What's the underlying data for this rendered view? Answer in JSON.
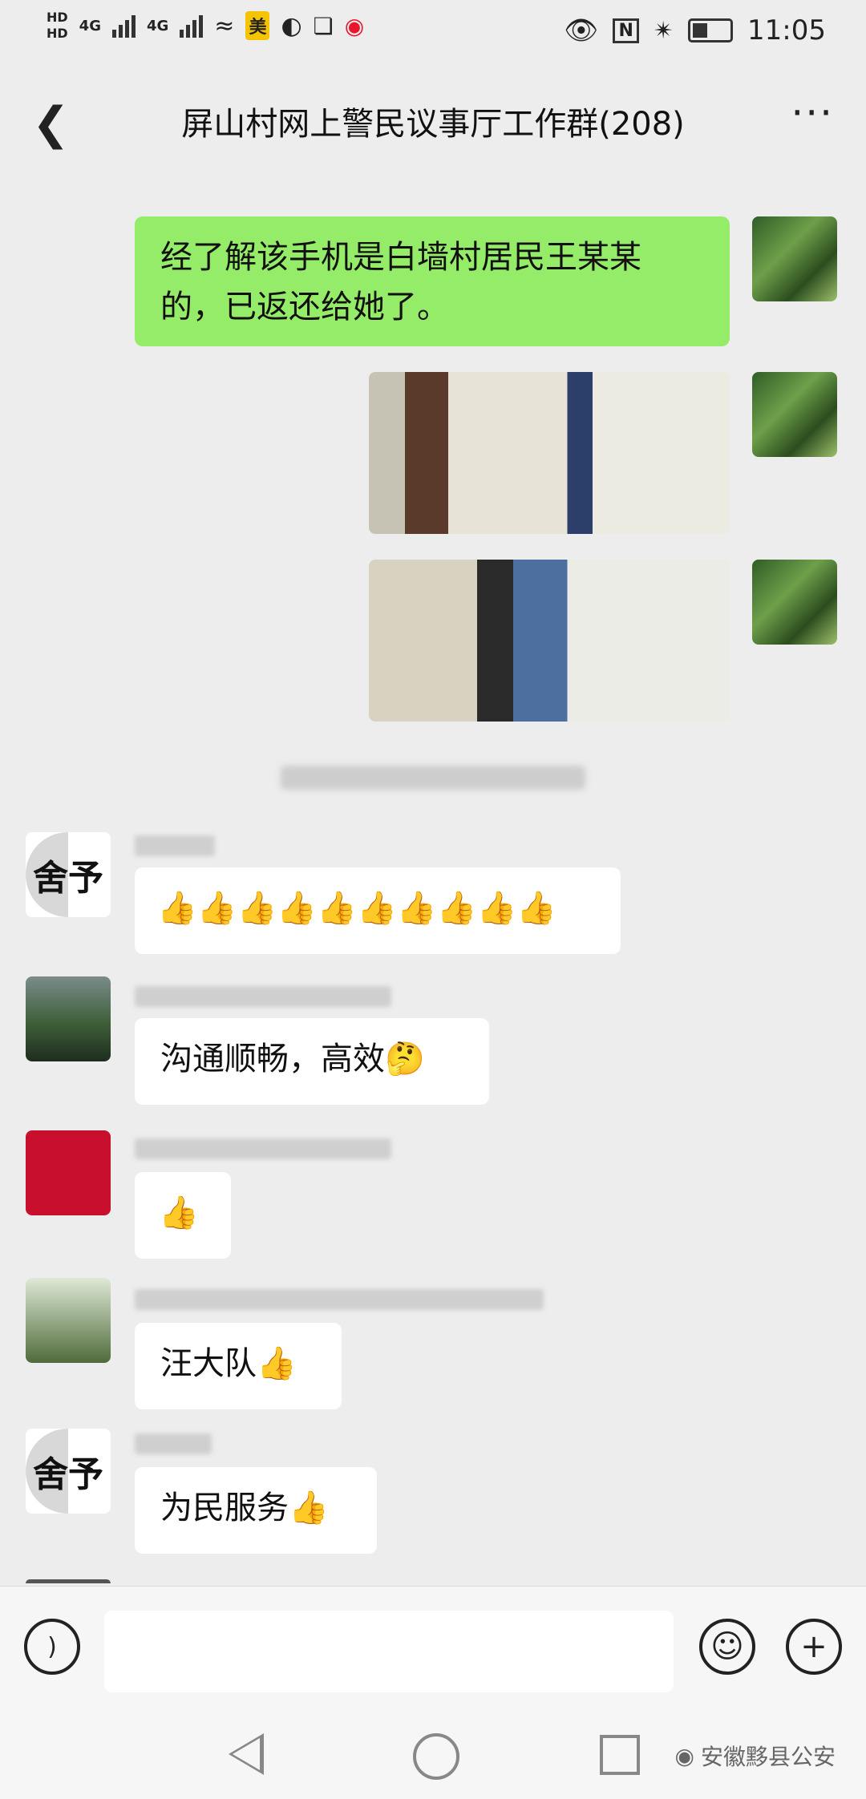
{
  "status": {
    "hd1": "HD",
    "hd2": "HD",
    "net1": "4G",
    "net2": "4G",
    "app_badge": "美",
    "time": "11:05",
    "nfc": "N"
  },
  "header": {
    "back_icon": "chevron-left-icon",
    "title": "屏山村网上警民议事厅工作群(208)",
    "more": "···"
  },
  "messages": {
    "outgoing_text": "经了解该手机是白墙村居民王某某的，已返还给她了。",
    "msg1": "👍👍👍👍👍👍👍👍👍👍",
    "msg1_avatar": "舍予",
    "msg2": "沟通顺畅，高效🤔",
    "msg3": "👍",
    "msg4": "汪大队👍",
    "msg5": "为民服务👍",
    "msg5_avatar": "舍予"
  },
  "bottom": {
    "voice_icon": "voice-icon",
    "emoji_icon": "emoji-icon",
    "plus_icon": "plus-icon",
    "plus": "+",
    "emoji": "☺"
  },
  "watermark": "安徽黟县公安"
}
